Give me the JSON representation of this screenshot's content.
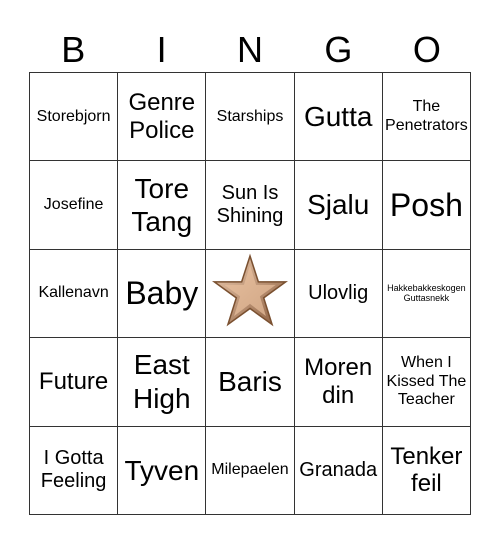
{
  "header": [
    "B",
    "I",
    "N",
    "G",
    "O"
  ],
  "cells": [
    {
      "text": "Storebjorn",
      "size": "sm"
    },
    {
      "text": "Genre Police",
      "size": "lg"
    },
    {
      "text": "Starships",
      "size": "sm"
    },
    {
      "text": "Gutta",
      "size": "xl"
    },
    {
      "text": "The Penetrators",
      "size": "sm"
    },
    {
      "text": "Josefine",
      "size": "sm"
    },
    {
      "text": "Tore Tang",
      "size": "xl"
    },
    {
      "text": "Sun Is Shining",
      "size": "md"
    },
    {
      "text": "Sjalu",
      "size": "xl"
    },
    {
      "text": "Posh",
      "size": "xxl"
    },
    {
      "text": "Kallenavn",
      "size": "sm"
    },
    {
      "text": "Baby",
      "size": "xxl"
    },
    {
      "text": "",
      "free": true,
      "icon": "star-icon"
    },
    {
      "text": "Ulovlig",
      "size": "md"
    },
    {
      "text": "Hakkebakkeskogen Guttasnekk",
      "size": "xs"
    },
    {
      "text": "Future",
      "size": "lg"
    },
    {
      "text": "East High",
      "size": "xl"
    },
    {
      "text": "Baris",
      "size": "xl"
    },
    {
      "text": "Moren din",
      "size": "lg"
    },
    {
      "text": "When I Kissed The Teacher",
      "size": "sm"
    },
    {
      "text": "I Gotta Feeling",
      "size": "md"
    },
    {
      "text": "Tyven",
      "size": "xl"
    },
    {
      "text": "Milepaelen",
      "size": "sm"
    },
    {
      "text": "Granada",
      "size": "md"
    },
    {
      "text": "Tenker feil",
      "size": "lg"
    }
  ],
  "colors": {
    "star_light": "#f0cfb4",
    "star_dark": "#8a5c3c",
    "grid_line": "#333333"
  }
}
